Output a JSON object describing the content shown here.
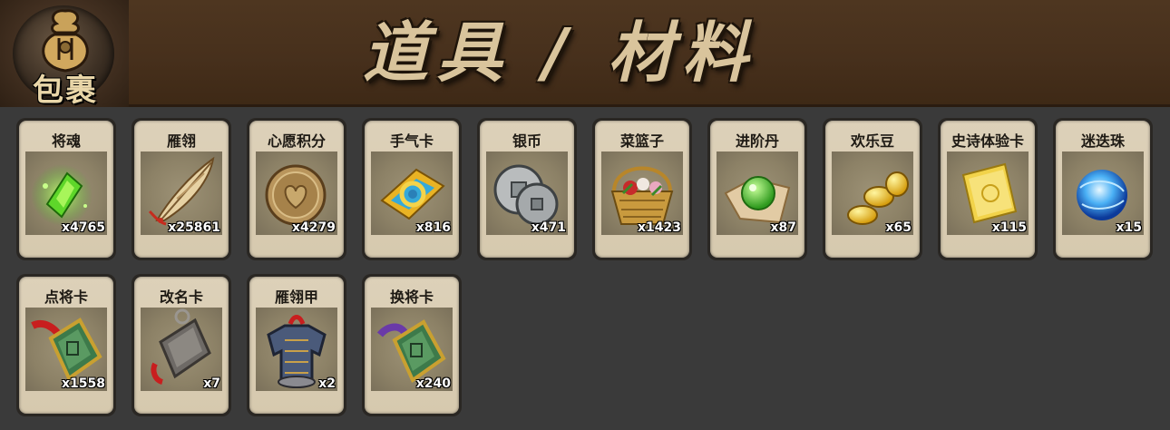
{
  "header": {
    "bag_label": "包裹",
    "title": "道具 / 材料"
  },
  "items": [
    {
      "name": "将魂",
      "count": "x4765",
      "icon": "green-soul-crystal-icon"
    },
    {
      "name": "雁翎",
      "count": "x25861",
      "icon": "goose-feather-icon"
    },
    {
      "name": "心愿积分",
      "count": "x4279",
      "icon": "heart-coin-icon"
    },
    {
      "name": "手气卡",
      "count": "x816",
      "icon": "luck-card-icon"
    },
    {
      "name": "银币",
      "count": "x471",
      "icon": "silver-coins-icon"
    },
    {
      "name": "菜篮子",
      "count": "x1423",
      "icon": "flower-basket-icon"
    },
    {
      "name": "进阶丹",
      "count": "x87",
      "icon": "green-pill-icon"
    },
    {
      "name": "欢乐豆",
      "count": "x65",
      "icon": "gold-beans-icon"
    },
    {
      "name": "史诗体验卡",
      "count": "x115",
      "icon": "epic-trial-card-icon"
    },
    {
      "name": "迷迭珠",
      "count": "x15",
      "icon": "blue-orb-icon"
    },
    {
      "name": "点将卡",
      "count": "x1558",
      "icon": "general-select-card-icon"
    },
    {
      "name": "改名卡",
      "count": "x7",
      "icon": "rename-card-icon"
    },
    {
      "name": "雁翎甲",
      "count": "x2",
      "icon": "armor-icon"
    },
    {
      "name": "换将卡",
      "count": "x240",
      "icon": "general-swap-card-icon"
    }
  ]
}
